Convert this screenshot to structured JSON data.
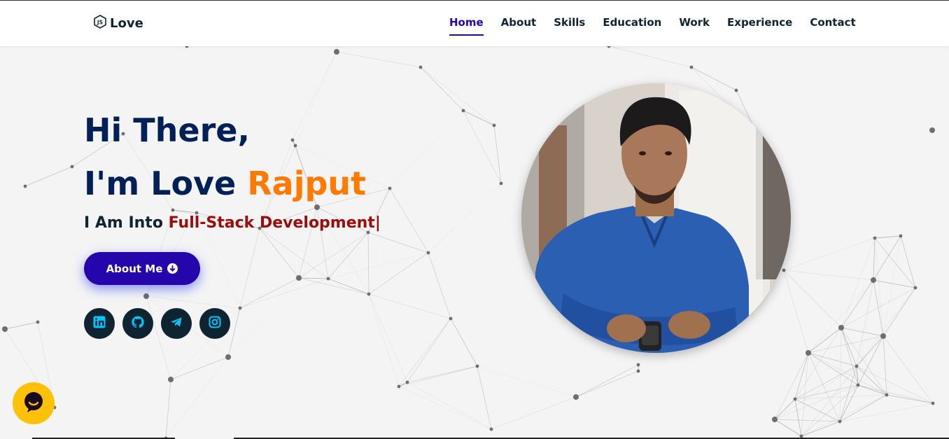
{
  "brand": {
    "name": "Love",
    "icon": "js-hexagon-icon"
  },
  "nav": {
    "items": [
      {
        "label": "Home",
        "active": true
      },
      {
        "label": "About",
        "active": false
      },
      {
        "label": "Skills",
        "active": false
      },
      {
        "label": "Education",
        "active": false
      },
      {
        "label": "Work",
        "active": false
      },
      {
        "label": "Experience",
        "active": false
      },
      {
        "label": "Contact",
        "active": false
      }
    ]
  },
  "hero": {
    "greeting": "Hi There,",
    "intro_prefix": "I'm Love",
    "intro_accent": "Rajput",
    "subtitle_prefix": "I Am Into",
    "typed_text": "Full-Stack Development",
    "cursor": "|",
    "about_button": {
      "label": "About Me",
      "icon": "arrow-down-circle-icon"
    }
  },
  "socials": [
    {
      "name": "linkedin",
      "icon": "linkedin-icon"
    },
    {
      "name": "github",
      "icon": "github-icon"
    },
    {
      "name": "telegram",
      "icon": "telegram-icon"
    },
    {
      "name": "instagram",
      "icon": "instagram-icon"
    }
  ],
  "chat_widget": {
    "icon": "chat-bubble-icon"
  },
  "colors": {
    "primary": "#2506ad",
    "heading": "#002057",
    "accent": "#ff7a00",
    "typed": "#9b0c0c",
    "social_bg": "#0e2431",
    "social_icon": "#00c6ff",
    "chat_bg": "#ffc107",
    "background": "#f4f4f4"
  }
}
